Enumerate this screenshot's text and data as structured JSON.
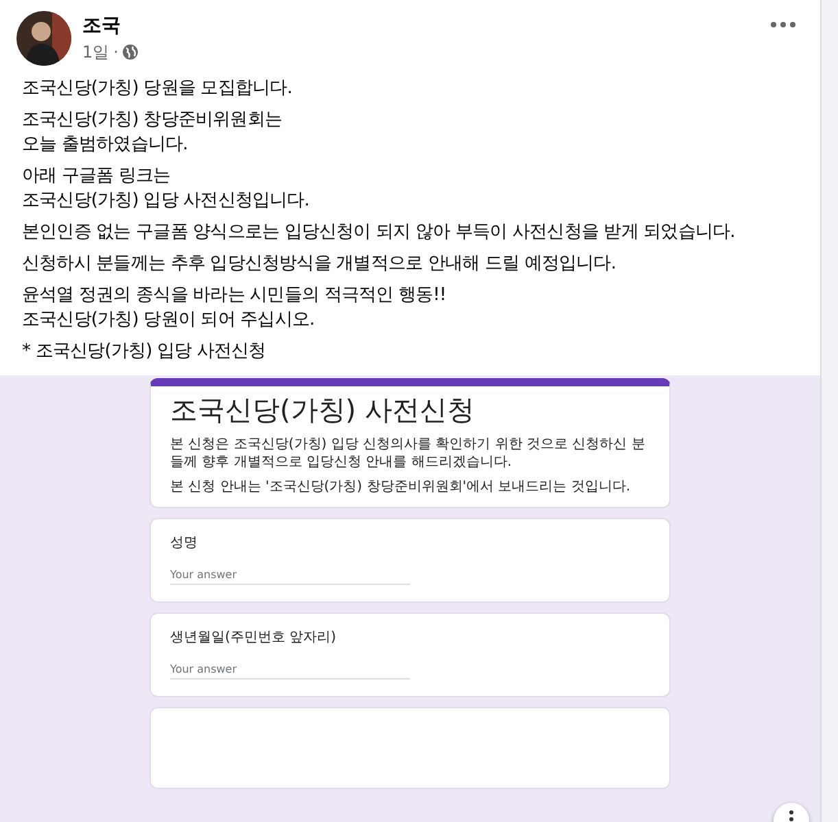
{
  "post": {
    "author": "조국",
    "time": "1일",
    "dot": "·",
    "paragraphs": [
      [
        "조국신당(가칭) 당원을 모집합니다."
      ],
      [
        "조국신당(가칭) 창당준비위원회는",
        "오늘 출범하였습니다."
      ],
      [
        "아래 구글폼 링크는",
        "조국신당(가칭) 입당 사전신청입니다."
      ],
      [
        "본인인증 없는 구글폼 양식으로는 입당신청이 되지 않아 부득이 사전신청을 받게 되었습니다."
      ],
      [
        "신청하시 분들께는 추후 입당신청방식을 개별적으로 안내해 드릴 예정입니다."
      ],
      [
        "윤석열 정권의 종식을 바라는 시민들의 적극적인 행동!!",
        "조국신당(가칭) 당원이 되어 주십시오."
      ],
      [
        "* 조국신당(가칭) 입당 사전신청"
      ]
    ]
  },
  "form": {
    "title": "조국신당(가칭) 사전신청",
    "description": [
      "본 신청은 조국신당(가칭) 입당 신청의사를 확인하기 위한 것으로 신청하신 분들께 향후 개별적으로 입당신청 안내를 해드리겠습니다.",
      "본 신청 안내는 '조국신당(가칭) 창당준비위원회'에서 보내드리는 것입니다."
    ],
    "questions": [
      {
        "label": "성명",
        "placeholder": "Your answer"
      },
      {
        "label": "생년월일(주민번호 앞자리)",
        "placeholder": "Your answer"
      }
    ]
  }
}
